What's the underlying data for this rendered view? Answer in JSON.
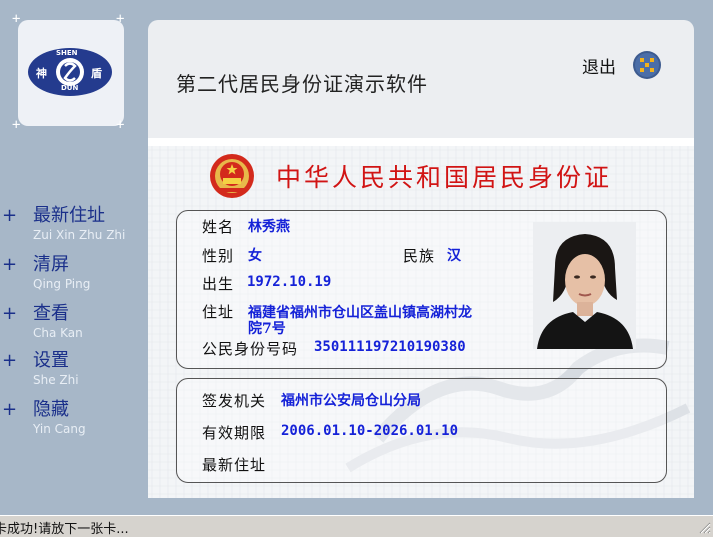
{
  "window": {
    "app_title": "第二代居民身份证演示软件",
    "exit_label": "退出"
  },
  "logo": {
    "left_text": "神",
    "right_text": "盾",
    "top_text": "SHEN",
    "bottom_text": "DUN"
  },
  "sidebar": {
    "items": [
      {
        "label": "最新住址",
        "pinyin": "Zui Xin Zhu Zhi",
        "icon": "plus-icon"
      },
      {
        "label": "清屏",
        "pinyin": "Qing Ping",
        "icon": "plus-icon"
      },
      {
        "label": "查看",
        "pinyin": "Cha Kan",
        "icon": "plus-icon"
      },
      {
        "label": "设置",
        "pinyin": "She Zhi",
        "icon": "plus-icon"
      },
      {
        "label": "隐藏",
        "pinyin": "Yin Cang",
        "icon": "plus-icon"
      }
    ]
  },
  "card": {
    "title": "中华人民共和国居民身份证",
    "fields": {
      "name_label": "姓名",
      "name_value": "林秀燕",
      "gender_label": "性别",
      "gender_value": "女",
      "ethnicity_label": "民族",
      "ethnicity_value": "汉",
      "birth_label": "出生",
      "birth_value": "1972.10.19",
      "address_label": "住址",
      "address_line1": "福建省福州市仓山区盖山镇高湖村龙",
      "address_line2": "院7号",
      "id_label": "公民身份号码",
      "id_value": "350111197210190380"
    },
    "issue": {
      "authority_label": "签发机关",
      "authority_value": "福州市公安局仓山分局",
      "validity_label": "有效期限",
      "validity_value": "2006.01.10-2026.01.10",
      "new_address_label": "最新住址",
      "new_address_value": ""
    }
  },
  "status_bar": {
    "text": "卡成功!请放下一张卡..."
  },
  "colors": {
    "accent_blue": "#1522d8",
    "title_red": "#d11414",
    "sidebar_bg": "#a7b7c8",
    "nav_text": "#1a2f8a"
  }
}
